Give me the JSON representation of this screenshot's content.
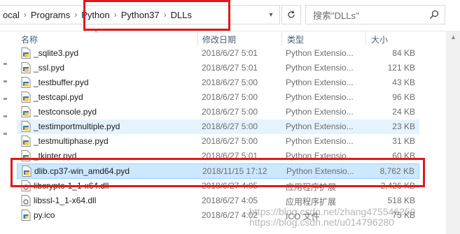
{
  "breadcrumb": {
    "items": [
      "ocal",
      "Programs",
      "Python",
      "Python37",
      "DLLs"
    ]
  },
  "search": {
    "placeholder": "搜索\"DLLs\""
  },
  "columns": {
    "name": "名称",
    "date": "修改日期",
    "type": "类型",
    "size": "大小"
  },
  "files": [
    {
      "name": "_sqlite3.pyd",
      "date": "2018/6/27 5:01",
      "type": "Python Extensio...",
      "size": "84 KB"
    },
    {
      "name": "_ssl.pyd",
      "date": "2018/6/27 5:01",
      "type": "Python Extensio...",
      "size": "121 KB"
    },
    {
      "name": "_testbuffer.pyd",
      "date": "2018/6/27 5:00",
      "type": "Python Extensio...",
      "size": "43 KB"
    },
    {
      "name": "_testcapi.pyd",
      "date": "2018/6/27 5:00",
      "type": "Python Extensio...",
      "size": "96 KB"
    },
    {
      "name": "_testconsole.pyd",
      "date": "2018/6/27 5:00",
      "type": "Python Extensio...",
      "size": "24 KB"
    },
    {
      "name": "_testimportmultiple.pyd",
      "date": "2018/6/27 5:00",
      "type": "Python Extensio...",
      "size": "23 KB"
    },
    {
      "name": "_testmultiphase.pyd",
      "date": "2018/6/27 5:00",
      "type": "Python Extensio...",
      "size": "31 KB"
    },
    {
      "name": "_tkinter.pyd",
      "date": "2018/6/27 5:01",
      "type": "Python Extensio...",
      "size": "60 KB"
    },
    {
      "name": "dlib.cp37-win_amd64.pyd",
      "date": "2018/11/15 17:12",
      "type": "Python Extensio...",
      "size": "8,762 KB"
    },
    {
      "name": "libcrypto-1_1-x64.dll",
      "date": "2018/6/27 4:05",
      "type": "应用程序扩展",
      "size": "2,426 KB"
    },
    {
      "name": "libssl-1_1-x64.dll",
      "date": "2018/6/27 4:05",
      "type": "应用程序扩展",
      "size": "518 KB"
    },
    {
      "name": "py.ico",
      "date": "2018/6/27 4:02",
      "type": "ICO 文件",
      "size": "75 KB"
    }
  ],
  "watermark": {
    "line1": "https://blog.csdn.net/zhang475546259",
    "line2": "https://blog.csdn.net/u014796280"
  },
  "colors": {
    "annotation": "#e0181d",
    "selection": "#cce8ff",
    "hover": "#e5f3ff"
  }
}
